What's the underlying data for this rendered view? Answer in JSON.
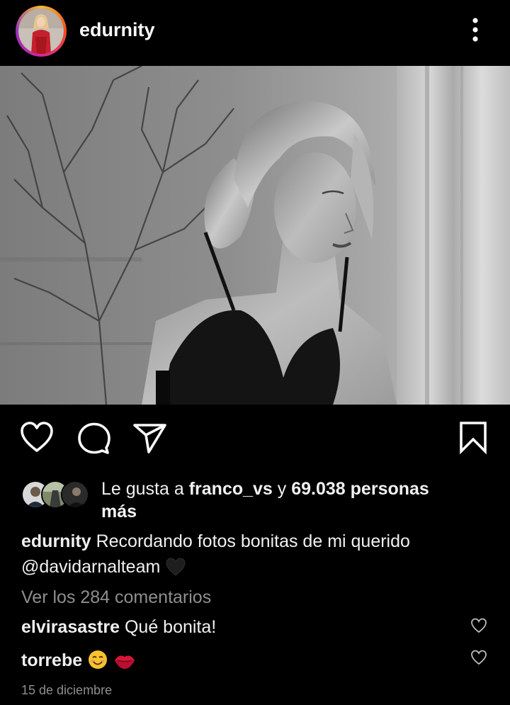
{
  "post": {
    "username": "edurnity",
    "more_icon": "vertical-ellipsis-icon",
    "photo_alt": "Black and white photo"
  },
  "actions": {
    "like_icon": "heart-outline-icon",
    "comment_icon": "comment-bubble-icon",
    "share_icon": "paper-plane-icon",
    "save_icon": "bookmark-outline-icon"
  },
  "likes": {
    "prefix": "Le gusta a ",
    "user": "franco_vs",
    "connector": " y ",
    "count": "69.038 personas",
    "suffix": "más"
  },
  "caption": {
    "username": "edurnity",
    "text": "Recordando fotos bonitas de mi querido",
    "mention": "@davidarnalteam",
    "emoji": "black-heart-emoji"
  },
  "comments": {
    "view_all": "Ver los 284 comentarios",
    "items": [
      {
        "username": "elvirasastre",
        "text": "Qué bonita!"
      },
      {
        "username": "torrebe",
        "text": ""
      }
    ]
  },
  "date": "15 de diciembre",
  "colors": {
    "background": "#000000",
    "text": "#f0f0f0",
    "muted": "#8e8e8e",
    "lips": "#d7153a",
    "smile": "#f9c22e"
  }
}
